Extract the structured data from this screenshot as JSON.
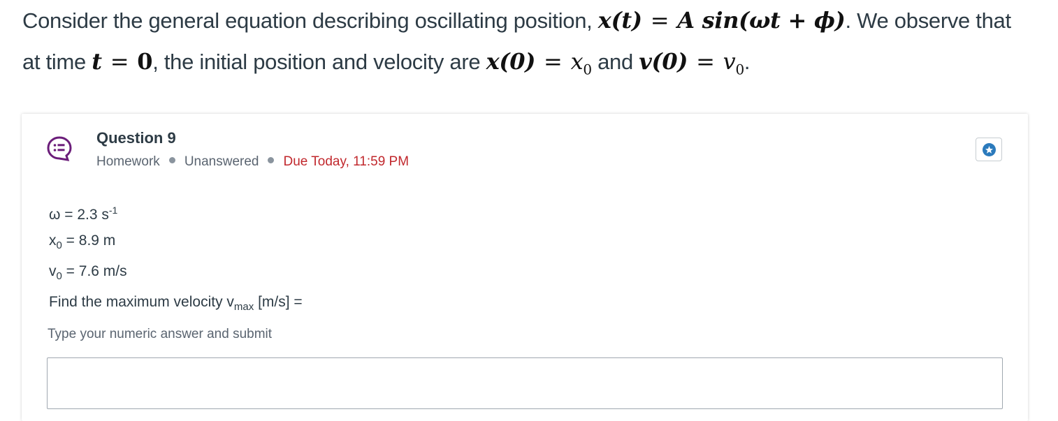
{
  "intro": {
    "line1_text": "Consider the general equation describing oscillating position, ",
    "line1_math_lhs": "x(t)",
    "line1_math_rhs": "A sin(ωt + ϕ)",
    "line1_tail": ". We observe that",
    "line2_text_a": "at time ",
    "line2_math_t": "t",
    "line2_math_t_val": "0",
    "line2_text_b": ", the initial position and velocity are ",
    "line2_math_x0_lhs": "x(0)",
    "line2_math_x0_rhs": "x",
    "line2_math_x0_sub": "0",
    "line2_text_c": " and ",
    "line2_math_v0_lhs": "v(0)",
    "line2_math_v0_rhs": "v",
    "line2_math_v0_sub": "0",
    "line2_tail": "."
  },
  "question": {
    "icon": "question-bubble-icon",
    "icon_color": "#6b1d7a",
    "title": "Question 9",
    "meta": {
      "type": "Homework",
      "status": "Unanswered",
      "due": "Due Today, 11:59 PM",
      "due_color": "#c1282d"
    },
    "star_button_icon": "star-icon",
    "given": {
      "omega_prefix": "ω = 2.3 s",
      "omega_exp": "-1",
      "x0_var": "x",
      "x0_sub": "0",
      "x0_val": " = 8.9 m",
      "v0_var": "v",
      "v0_sub": "0",
      "v0_val": " = 7.6 m/s",
      "prompt_prefix": "Find the maximum velocity v",
      "prompt_sub": "max",
      "prompt_suffix": " [m/s] ="
    },
    "answer_hint": "Type your numeric answer and submit",
    "answer_value": ""
  }
}
